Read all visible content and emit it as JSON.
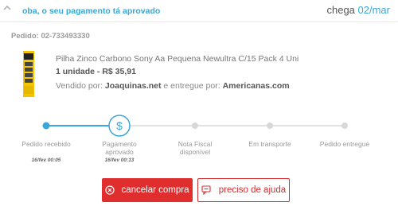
{
  "header": {
    "status": "oba, o seu pagamento tá aprovado",
    "delivery_prefix": "chega",
    "delivery_date": "02/mar"
  },
  "order": {
    "id_label": "Pedido: 02-733493330"
  },
  "product": {
    "name": "Pilha Zinco Carbono Sony Aa Pequena Newultra C/15 Pack 4 Uni",
    "quantity_price": "1 unidade - R$ 35,91",
    "sold_by_label": "Vendido por:",
    "seller": "Joaquinas.net",
    "delivered_by_label": "e entregue por:",
    "deliverer": "Americanas.com",
    "thumb_icon": "battery-pack-icon"
  },
  "tracker": {
    "accent": "#3aa7d6",
    "inactive": "#d8d8d8",
    "steps": [
      {
        "label": "Pedido recebido",
        "time": "16/fev 00:05",
        "status": "done"
      },
      {
        "label": "Pagamento aprovado",
        "time": "16/fev 00:13",
        "status": "current",
        "icon": "dollar-icon"
      },
      {
        "label": "Nota Fiscal disponível",
        "time": "",
        "status": "pending"
      },
      {
        "label": "Em transporte",
        "time": "",
        "status": "pending"
      },
      {
        "label": "Pedido entregue",
        "time": "",
        "status": "pending"
      }
    ]
  },
  "actions": {
    "cancel_label": "cancelar compra",
    "cancel_icon": "close-circle-icon",
    "help_label": "preciso de ajuda",
    "help_icon": "chat-bubble-icon",
    "brand_red": "#e02d2d"
  }
}
